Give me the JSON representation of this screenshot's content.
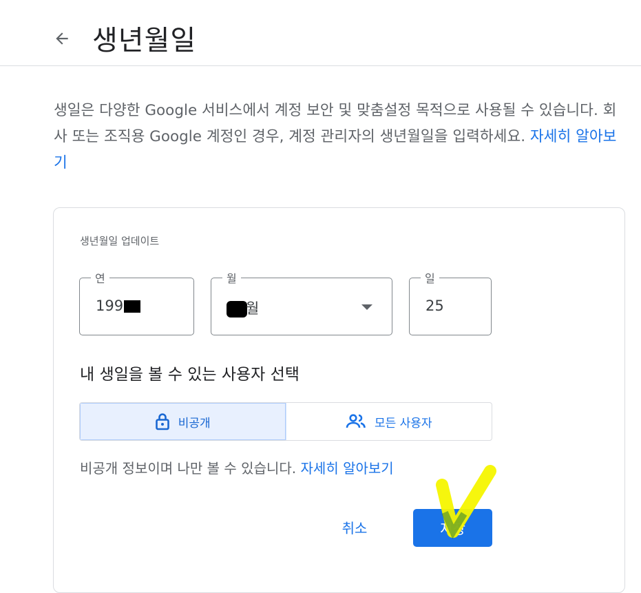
{
  "header": {
    "title": "생년월일",
    "back_icon": "arrow-back-icon"
  },
  "intro": {
    "text": "생일은 다양한 Google 서비스에서 계정 보안 및 맞춤설정 목적으로 사용될 수 있습니다. 회사 또는 조직용 Google 계정인 경우, 계정 관리자의 생년월일을 입력하세요.",
    "link": "자세히 알아보기"
  },
  "card": {
    "title": "생년월일 업데이트",
    "year": {
      "label": "연",
      "value": "199"
    },
    "month": {
      "label": "월",
      "value": "월"
    },
    "day": {
      "label": "일",
      "value": "25"
    },
    "visibility": {
      "heading": "내 생일을 볼 수 있는 사용자 선택",
      "options": [
        {
          "label": "비공개",
          "icon": "lock-icon",
          "selected": true
        },
        {
          "label": "모든 사용자",
          "icon": "people-icon",
          "selected": false
        }
      ],
      "note": "비공개 정보이며 나만 볼 수 있습니다.",
      "note_link": "자세히 알아보기"
    },
    "cancel_label": "취소",
    "save_label": "저장"
  },
  "colors": {
    "accent": "#1a73e8",
    "selected_bg": "#e8f0fe",
    "annotation_yellow": "#ffff00",
    "annotation_green": "#2e7d32"
  }
}
